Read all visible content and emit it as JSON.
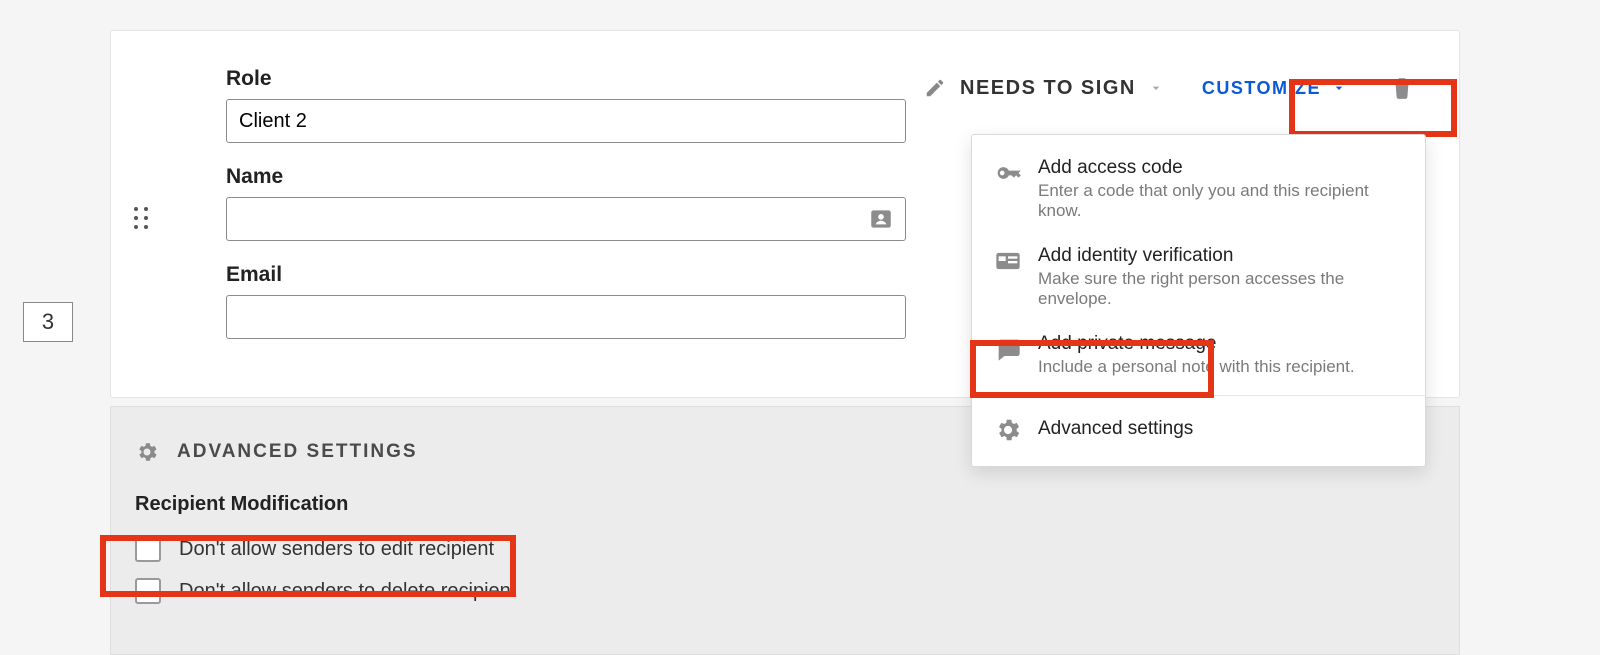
{
  "sequence_number": "3",
  "role": {
    "label": "Role",
    "value": "Client 2"
  },
  "name": {
    "label": "Name",
    "value": ""
  },
  "email": {
    "label": "Email",
    "value": ""
  },
  "needs_to_sign_label": "NEEDS TO SIGN",
  "customize_label": "CUSTOMIZE",
  "customize_menu": {
    "access_code": {
      "title": "Add access code",
      "sub": "Enter a code that only you and this recipient know."
    },
    "identity": {
      "title": "Add identity verification",
      "sub": "Make sure the right person accesses the envelope."
    },
    "private_msg": {
      "title": "Add private message",
      "sub": "Include a personal note with this recipient."
    },
    "advanced": {
      "title": "Advanced settings"
    }
  },
  "advanced_panel": {
    "title": "ADVANCED SETTINGS",
    "section_heading": "Recipient Modification",
    "opt_edit": "Don't allow senders to edit recipient",
    "opt_delete": "Don't allow senders to delete recipient"
  }
}
